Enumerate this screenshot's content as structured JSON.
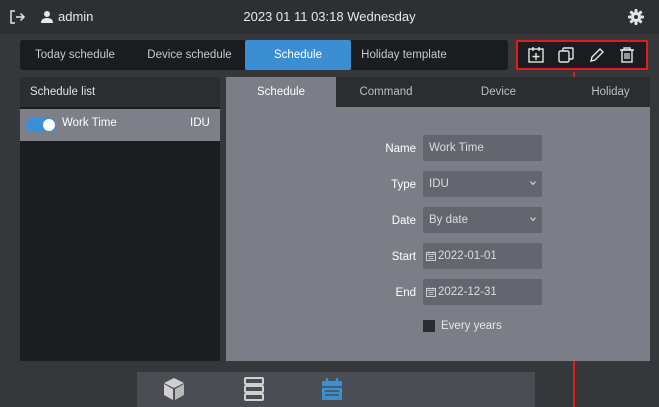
{
  "header": {
    "username": "admin",
    "datetime": "2023 01 11 03:18 Wednesday"
  },
  "tabs": [
    "Today schedule",
    "Device schedule",
    "Schedule",
    "Holiday template"
  ],
  "active_tab": "Schedule",
  "toolbar": {
    "icons": [
      "add-schedule-icon",
      "copy-icon",
      "edit-icon",
      "delete-icon"
    ]
  },
  "schedule_list": {
    "title": "Schedule list",
    "items": [
      {
        "name": "Work Time",
        "type": "IDU",
        "enabled": true
      }
    ]
  },
  "detail_tabs": [
    "Schedule",
    "Command",
    "Device",
    "Holiday"
  ],
  "active_detail_tab": "Schedule",
  "form": {
    "name_label": "Name",
    "name_value": "Work Time",
    "type_label": "Type",
    "type_value": "IDU",
    "date_label": "Date",
    "date_value": "By date",
    "start_label": "Start",
    "start_value": "2022-01-01",
    "end_label": "End",
    "end_value": "2022-12-31",
    "every_years_label": "Every years",
    "every_years_checked": false
  },
  "bottom_nav": {
    "items": [
      "device-icon",
      "device-list-icon",
      "schedule-calendar-icon"
    ],
    "active": "schedule-calendar-icon"
  },
  "colors": {
    "accent": "#3c8ed3",
    "highlight_box": "#e41b1b"
  }
}
